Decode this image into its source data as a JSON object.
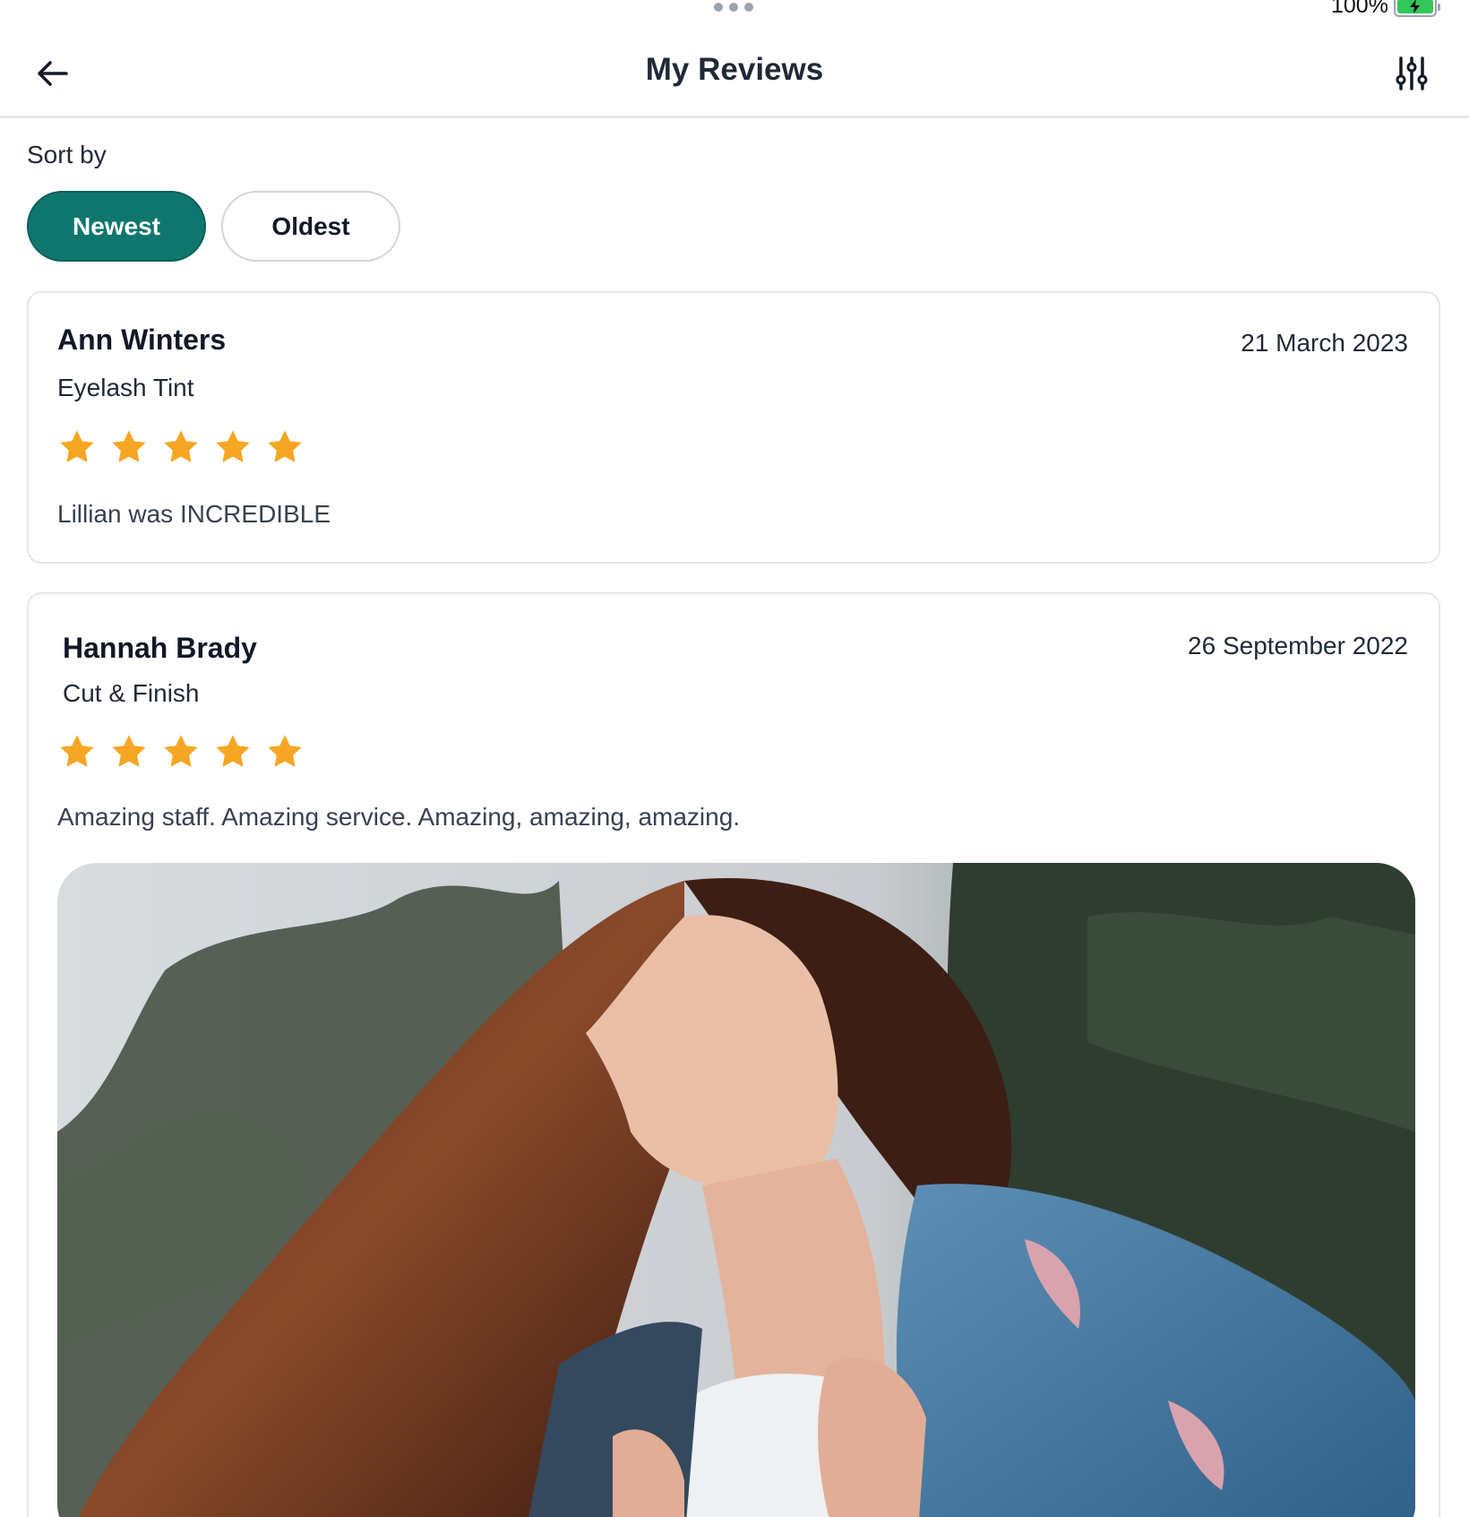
{
  "status_bar": {
    "battery_text": "100%",
    "battery_level": 1.0
  },
  "header": {
    "title": "My Reviews",
    "back_icon": "arrow-left-icon",
    "filter_icon": "sliders-icon"
  },
  "sort": {
    "label": "Sort by",
    "options": [
      "Newest",
      "Oldest"
    ],
    "selected": "Newest"
  },
  "colors": {
    "accent": "#0f766e",
    "star": "#f6a623",
    "card_border": "#e5e7eb"
  },
  "reviews": [
    {
      "name": "Ann Winters",
      "service": "Eyelash Tint",
      "date": "21 March 2023",
      "rating": 5,
      "comment": "Lillian was INCREDIBLE"
    },
    {
      "name": "Hannah Brady",
      "service": "Cut & Finish",
      "date": "26 September 2022",
      "rating": 5,
      "comment": "Amazing staff. Amazing service. Amazing, amazing, amazing.",
      "has_photo": true
    }
  ]
}
